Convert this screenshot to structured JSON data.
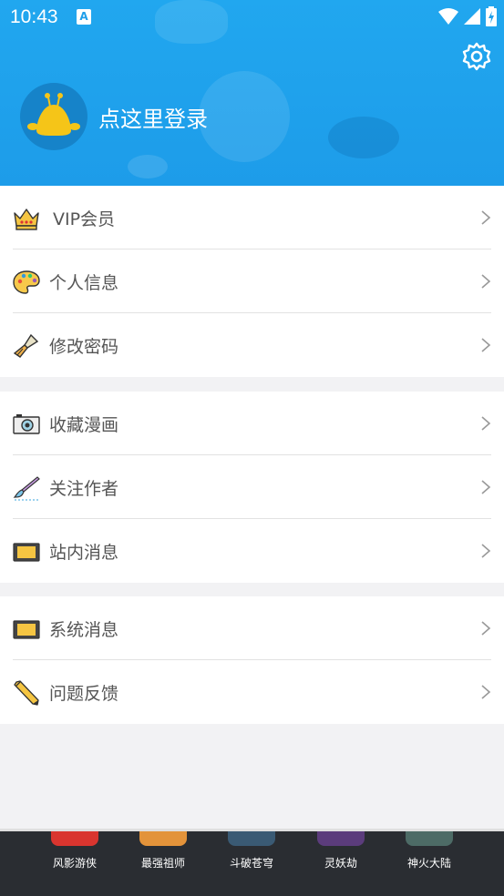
{
  "status_bar": {
    "time": "10:43",
    "a_badge": "A"
  },
  "header": {
    "login_text": "点这里登录"
  },
  "groups": [
    {
      "items": [
        {
          "label": "VIP会员",
          "icon": "crown-icon"
        },
        {
          "label": "个人信息",
          "icon": "palette-icon"
        },
        {
          "label": "修改密码",
          "icon": "brush-icon"
        }
      ]
    },
    {
      "items": [
        {
          "label": "收藏漫画",
          "icon": "camera-icon"
        },
        {
          "label": "关注作者",
          "icon": "paintbrush-icon"
        },
        {
          "label": "站内消息",
          "icon": "tablet-icon"
        }
      ]
    },
    {
      "items": [
        {
          "label": "系统消息",
          "icon": "tablet-icon"
        },
        {
          "label": "问题反馈",
          "icon": "pencil-icon"
        }
      ]
    }
  ],
  "bottom_bar": {
    "items": [
      {
        "label": "风影游侠",
        "color": "#d9352f"
      },
      {
        "label": "最强祖师",
        "color": "#e3933a"
      },
      {
        "label": "斗破苍穹",
        "color": "#3a5a74"
      },
      {
        "label": "灵妖劫",
        "color": "#5b3c7c"
      },
      {
        "label": "神火大陆",
        "color": "#4d6b66"
      }
    ]
  },
  "colors": {
    "header_blue": "#1d9ce9",
    "bottom_bg": "#2a2d32"
  }
}
